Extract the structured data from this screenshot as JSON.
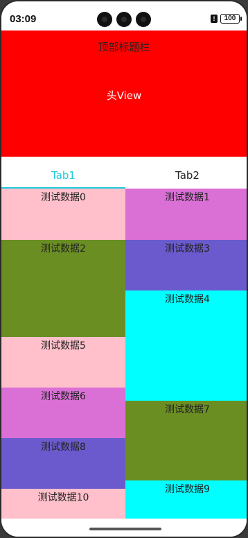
{
  "status_bar": {
    "time": "03:09",
    "battery": "100"
  },
  "header": {
    "top_title": "顶部标题栏",
    "head_view": "头View",
    "color": "#ff0000"
  },
  "tabs": [
    {
      "label": "Tab1",
      "active": true
    },
    {
      "label": "Tab2",
      "active": false
    }
  ],
  "colors": {
    "accent": "#1ec8dc"
  },
  "items": [
    {
      "label": "测试数据0",
      "color": "#ffc0cb"
    },
    {
      "label": "测试数据1",
      "color": "#da70d6"
    },
    {
      "label": "测试数据2",
      "color": "#6b8e23"
    },
    {
      "label": "测试数据3",
      "color": "#6a5acd"
    },
    {
      "label": "测试数据4",
      "color": "#00ffff"
    },
    {
      "label": "测试数据5",
      "color": "#ffc0cb"
    },
    {
      "label": "测试数据6",
      "color": "#da70d6"
    },
    {
      "label": "测试数据7",
      "color": "#6b8e23"
    },
    {
      "label": "测试数据8",
      "color": "#6a5acd"
    },
    {
      "label": "测试数据9",
      "color": "#00ffff"
    },
    {
      "label": "测试数据10",
      "color": "#ffc0cb"
    }
  ]
}
